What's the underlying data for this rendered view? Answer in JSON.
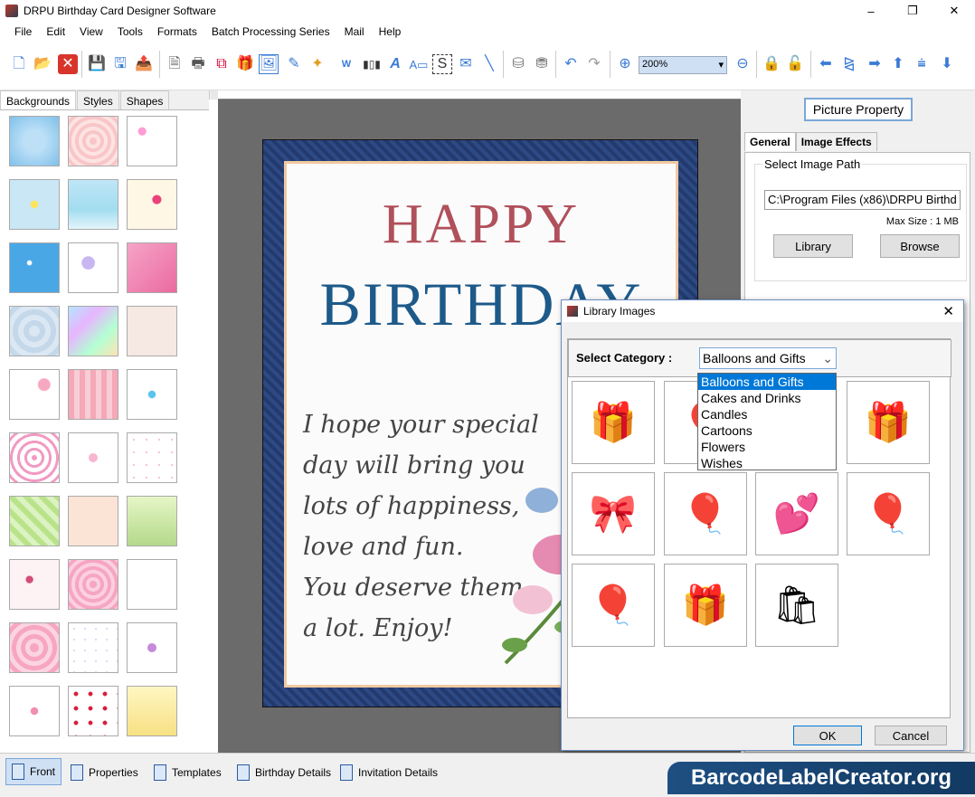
{
  "window": {
    "title": "DRPU Birthday Card Designer Software",
    "controls": [
      "–",
      "❐",
      "✕"
    ]
  },
  "menu": [
    "File",
    "Edit",
    "View",
    "Tools",
    "Formats",
    "Batch Processing Series",
    "Mail",
    "Help"
  ],
  "toolbar": {
    "zoom_value": "200%"
  },
  "left_panel": {
    "tabs": [
      "Backgrounds",
      "Styles",
      "Shapes"
    ],
    "active_tab": "Backgrounds"
  },
  "card": {
    "title_line1": "HAPPY",
    "title_line2": "BIRTHDAY",
    "message": [
      "I hope your special",
      "day will bring you",
      "lots of happiness,",
      "love and fun.",
      "You deserve them",
      "a lot. Enjoy!"
    ],
    "title_color1": "#b0505b",
    "title_color2": "#1d5a8a"
  },
  "right_panel": {
    "header": "Picture Property",
    "tabs": [
      "General",
      "Image Effects"
    ],
    "group_label": "Select Image Path",
    "path_value": "C:\\Program Files (x86)\\DRPU Birthd",
    "max_size": "Max Size : 1 MB",
    "library_button": "Library",
    "browse_button": "Browse"
  },
  "dialog": {
    "title": "Library Images",
    "category_label": "Select Category :",
    "selected_category": "Balloons and Gifts",
    "categories": [
      "Balloons and Gifts",
      "Cakes and Drinks",
      "Candles",
      "Cartoons",
      "Flowers",
      "Wishes"
    ],
    "ok_button": "OK",
    "cancel_button": "Cancel"
  },
  "bottom_bar": {
    "items": [
      "Front",
      "Properties",
      "Templates",
      "Birthday Details",
      "Invitation Details"
    ],
    "active": "Front"
  },
  "brand": "BarcodeLabelCreator.org"
}
